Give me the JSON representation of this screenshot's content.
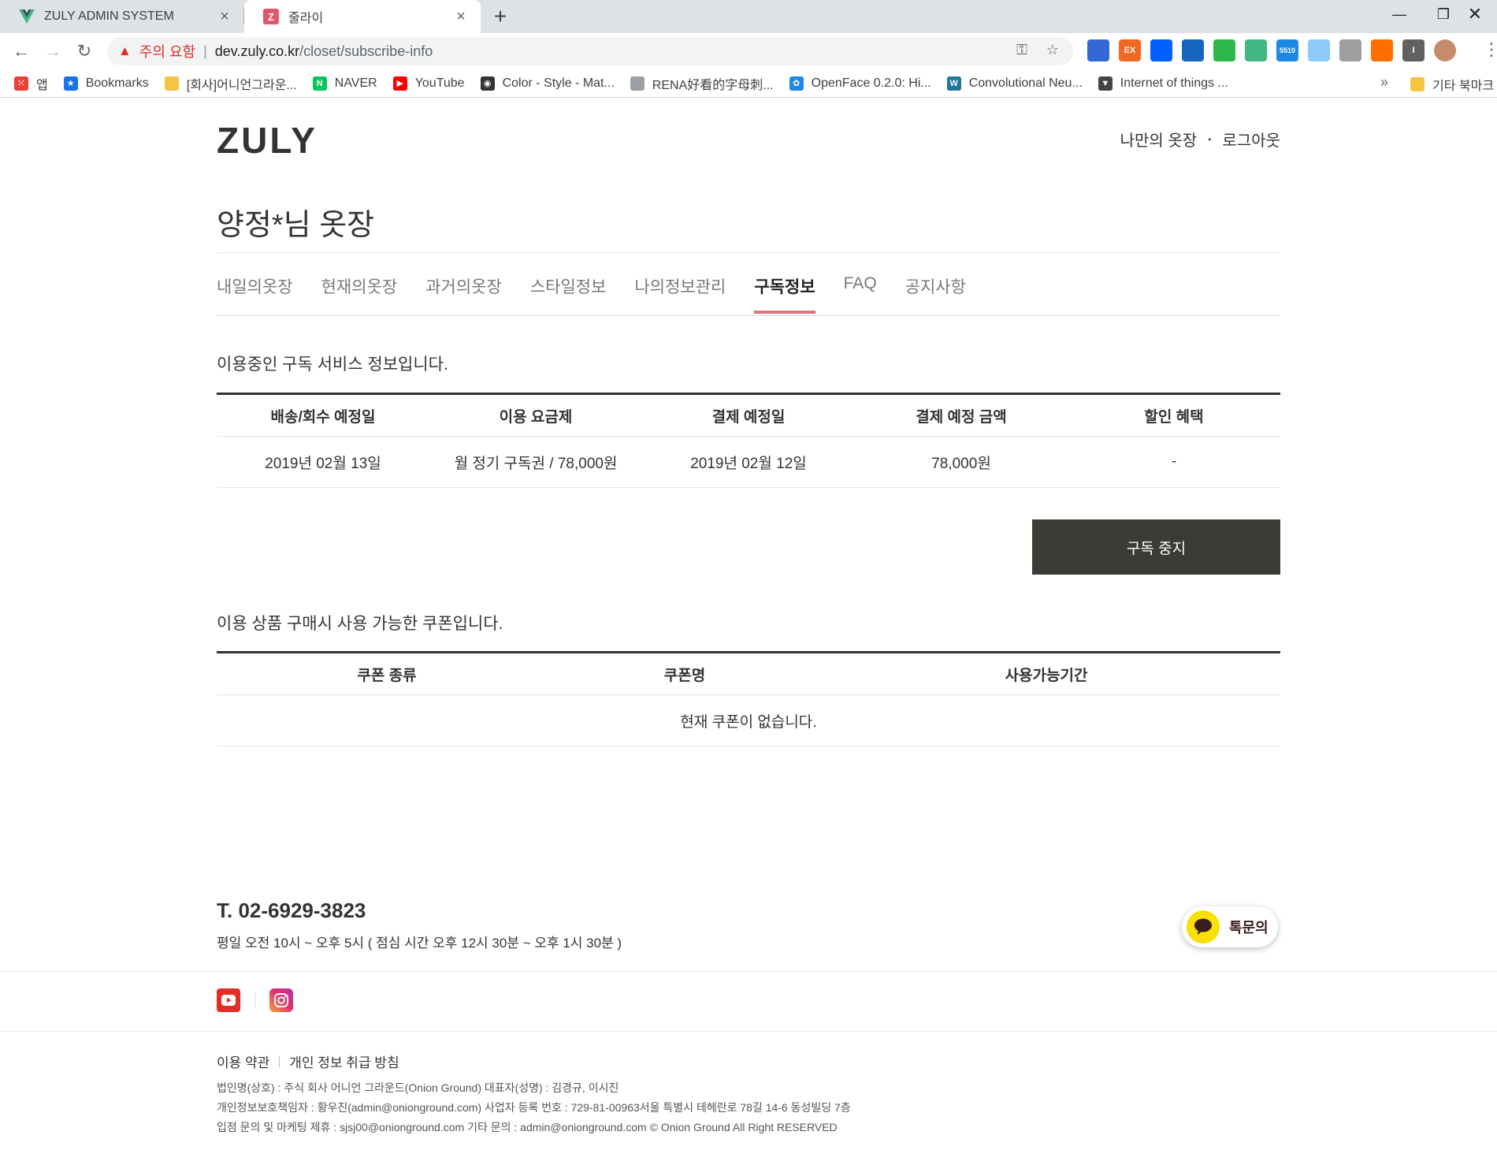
{
  "browser": {
    "tabs": [
      {
        "title": "ZULY ADMIN SYSTEM",
        "favicon": "vue-logo-icon"
      },
      {
        "title": "줄라이",
        "favicon": "zuly-z-icon"
      }
    ],
    "new_tab_label": "+",
    "omnibox": {
      "security_warning": "주의 요함",
      "url_host": "dev.zuly.co.kr",
      "url_path": "/closet/subscribe-info"
    },
    "extensions": [
      {
        "name": "globe-extension-icon",
        "color": "#3367d6",
        "text": ""
      },
      {
        "name": "ex-extension-icon",
        "color": "#f26722",
        "text": "EX"
      },
      {
        "name": "dropbox-icon",
        "color": "#0061ff",
        "text": ""
      },
      {
        "name": "window-extension-icon",
        "color": "#1565c0",
        "text": ""
      },
      {
        "name": "shield-check-icon",
        "color": "#2db84b",
        "text": ""
      },
      {
        "name": "vue-devtools-icon",
        "color": "#41b883",
        "text": ""
      },
      {
        "name": "counter-extension-icon",
        "color": "#1e88e5",
        "text": "5510"
      },
      {
        "name": "paper-plane-icon",
        "color": "#90caf9",
        "text": ""
      },
      {
        "name": "tag-extension-icon",
        "color": "#9e9e9e",
        "text": ""
      },
      {
        "name": "chart-extension-icon",
        "color": "#ff6f00",
        "text": ""
      },
      {
        "name": "info-extension-icon",
        "color": "#616161",
        "text": "I"
      },
      {
        "name": "profile-avatar-icon",
        "color": "#c58b6a",
        "text": ""
      }
    ],
    "bookmarks": [
      {
        "label": "앱",
        "icon": "apps-grid-icon",
        "color": "#e94235"
      },
      {
        "label": "Bookmarks",
        "icon": "star-icon",
        "color": "#1a73e8"
      },
      {
        "label": "[회사]어니언그라운...",
        "icon": "folder-icon",
        "color": "#f4c542"
      },
      {
        "label": "NAVER",
        "icon": "naver-icon",
        "color": "#03c75a"
      },
      {
        "label": "YouTube",
        "icon": "youtube-icon",
        "color": "#ff0000"
      },
      {
        "label": "Color - Style - Mat...",
        "icon": "material-icon",
        "color": "#333333"
      },
      {
        "label": "RENA好看的字母刺...",
        "icon": "page-icon",
        "color": "#9aa0a6"
      },
      {
        "label": "OpenFace 0.2.0: Hi...",
        "icon": "paw-icon",
        "color": "#1e88e5"
      },
      {
        "label": "Convolutional Neu...",
        "icon": "wordpress-icon",
        "color": "#21759b"
      },
      {
        "label": "Internet of things ...",
        "icon": "iot-icon",
        "color": "#444444"
      }
    ],
    "bookmarks_more": "»",
    "other_bookmarks": "기타 북마크"
  },
  "site": {
    "logo": "ZULY",
    "top_links": {
      "my_closet": "나만의 옷장",
      "dot": "•",
      "logout": "로그아웃"
    },
    "closet_title": "양정*님 옷장",
    "menu": [
      "내일의옷장",
      "현재의옷장",
      "과거의옷장",
      "스타일정보",
      "나의정보관리",
      "구독정보",
      "FAQ",
      "공지사항"
    ],
    "active_menu": "구독정보",
    "subscription": {
      "caption": "이용중인 구독 서비스 정보입니다.",
      "headers": [
        "배송/회수 예정일",
        "이용 요금제",
        "결제 예정일",
        "결제 예정 금액",
        "할인 혜택"
      ],
      "row": [
        "2019년 02월 13일",
        "월 정기 구독권 / 78,000원",
        "2019년 02월 12일",
        "78,000원",
        "-"
      ],
      "cancel_button": "구독 중지"
    },
    "coupons": {
      "caption": "이용 상품 구매시 사용 가능한 쿠폰입니다.",
      "headers": [
        "쿠폰 종류",
        "쿠폰명",
        "사용가능기간"
      ],
      "empty_message": "현재 쿠폰이 없습니다."
    }
  },
  "footer": {
    "phone": "T. 02-6929-3823",
    "hours": "평일 오전 10시 ~ 오후 5시 ( 점심 시간 오후 12시 30분 ~ 오후 1시 30분 )",
    "chat_label": "톡문의",
    "terms": "이용 약관",
    "privacy": "개인 정보 취급 방침",
    "company_line": "법인명(상호) : 주식 회사 어니언 그라운드(Onion Ground) 대표자(성명) : 김경규, 이시진",
    "privacy_line": "개인정보보호책임자 : 황우진(admin@onionground.com) 사업자 등록 번호 : 729-81-00963서울 특별시 테헤란로 78길 14-6 동성빌딩 7층",
    "contact_line": "입점 문의 및 마케팅 제휴 : sjsj00@onionground.com 기타 문의 : admin@onionground.com © Onion Ground All Right RESERVED"
  },
  "colors": {
    "accent": "#d9787f",
    "button_dark": "#3d3b35",
    "warning": "#d93025",
    "kakao_yellow": "#f9e000"
  }
}
